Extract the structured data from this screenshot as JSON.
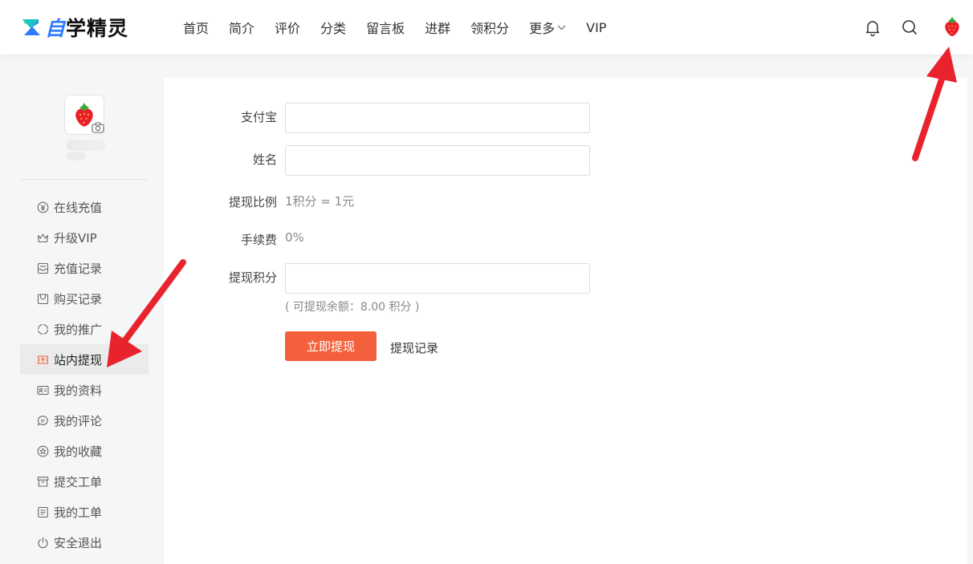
{
  "brand": {
    "first_char": "自",
    "rest": "学精灵",
    "accent": "#2f7bff",
    "icon": "logo-mark"
  },
  "nav": {
    "items": [
      {
        "label": "首页"
      },
      {
        "label": "简介"
      },
      {
        "label": "评价"
      },
      {
        "label": "分类"
      },
      {
        "label": "留言板"
      },
      {
        "label": "进群"
      },
      {
        "label": "领积分"
      },
      {
        "label": "更多",
        "has_dropdown": true
      },
      {
        "label": "VIP"
      }
    ],
    "right_icons": [
      "bell-icon",
      "search-icon",
      "strawberry-avatar-icon"
    ]
  },
  "sidebar": {
    "avatar_icon": "strawberry-avatar-icon",
    "camera_icon": "camera-icon",
    "menu": [
      {
        "label": "在线充值",
        "icon": "yen-circle-icon"
      },
      {
        "label": "升级VIP",
        "icon": "crown-icon"
      },
      {
        "label": "充值记录",
        "icon": "inbox-icon"
      },
      {
        "label": "购买记录",
        "icon": "bag-icon"
      },
      {
        "label": "我的推广",
        "icon": "loop-icon"
      },
      {
        "label": "站内提现",
        "icon": "yen-ticket-icon",
        "active": true
      },
      {
        "label": "我的资料",
        "icon": "id-card-icon"
      },
      {
        "label": "我的评论",
        "icon": "chat-icon"
      },
      {
        "label": "我的收藏",
        "icon": "star-circle-icon"
      },
      {
        "label": "提交工单",
        "icon": "archive-icon"
      },
      {
        "label": "我的工单",
        "icon": "list-doc-icon"
      },
      {
        "label": "安全退出",
        "icon": "power-icon"
      }
    ]
  },
  "form": {
    "alipay_label": "支付宝",
    "alipay_value": "",
    "name_label": "姓名",
    "name_value": "",
    "ratio_label": "提现比例",
    "ratio_value": "1积分 = 1元",
    "fee_label": "手续费",
    "fee_value": "0%",
    "points_label": "提现积分",
    "points_value": "",
    "balance_hint": "( 可提现余额：8.00 积分 )",
    "submit_label": "立即提现",
    "history_link": "提现记录",
    "button_color": "#f5603c"
  },
  "annotation": {
    "arrow_color": "#e8232e"
  }
}
